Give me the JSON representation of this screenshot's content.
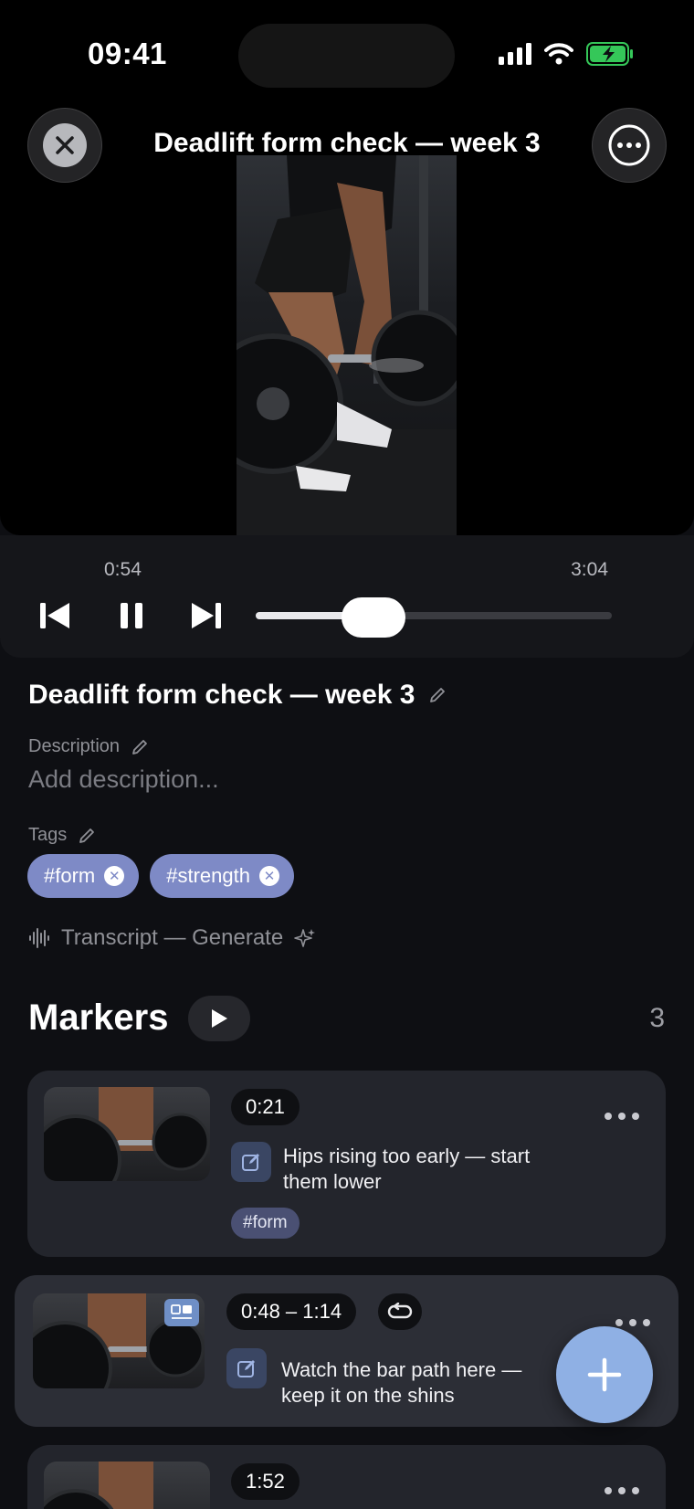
{
  "status_bar": {
    "time": "09:41"
  },
  "video": {
    "title": "Deadlift form check — week 3",
    "current_time": "0:54",
    "total_time": "3:04",
    "progress": 0.33
  },
  "details": {
    "title": "Deadlift form check — week 3",
    "description_label": "Description",
    "description_placeholder": "Add description...",
    "tags_label": "Tags",
    "tags": [
      "#form",
      "#strength"
    ],
    "transcript_label": "Transcript — Generate"
  },
  "markers": {
    "heading": "Markers",
    "count": "3",
    "items": [
      {
        "time": "0:21",
        "note_line1": "Hips rising too early — start",
        "note_line2": "them lower",
        "tag": "#form"
      },
      {
        "time": "0:48 – 1:14",
        "note_line1": "Watch the bar path here —",
        "note_line2": "keep it on the shins"
      },
      {
        "time": "1:52"
      }
    ]
  },
  "colors": {
    "accent": "#7e8ac6",
    "fab": "#8fb0e4",
    "battery": "#35c759"
  }
}
